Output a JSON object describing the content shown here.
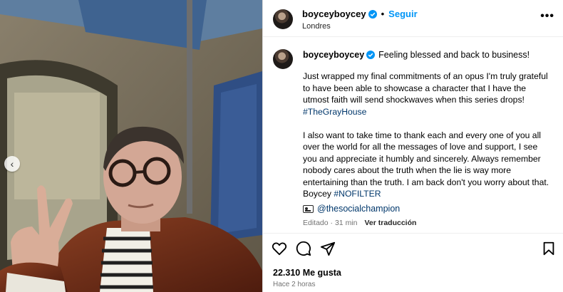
{
  "post": {
    "username": "boyceyboycey",
    "follow_label": "Seguir",
    "separator": "•",
    "location": "Londres",
    "more_label": "•••",
    "caption": {
      "username": "boyceyboycey",
      "first_line": "Feeling blessed and back to business!",
      "paragraph1": "Just wrapped my final commitments of an opus I'm truly grateful to have been able to showcase a character that I have the utmost faith will send shockwaves when this series drops!",
      "hashtag1": "#TheGrayHouse",
      "paragraph2": "I also want to take time to thank each and every one of you all over the world for all the messages of love and support, I see you and appreciate it humbly and sincerely. Always remember nobody cares about the truth when the lie is way more entertaining than the truth. I am back don't you worry about that. Boycey",
      "hashtag2": "#NOFILTER"
    },
    "credit_mention": "@thesocialchampion",
    "edited_label": "Editado",
    "edited_time": "31 min",
    "edited_sep": "·",
    "translate_label": "Ver traducción",
    "likes": "22.310 Me gusta",
    "posted_time": "Hace 2 horas",
    "carousel_prev": "‹"
  },
  "icons": {
    "verified": "verified-badge-icon",
    "like": "heart-icon",
    "comment": "comment-icon",
    "share": "share-icon",
    "save": "bookmark-icon",
    "tagged": "photo-tag-icon"
  },
  "colors": {
    "accent": "#0095f6",
    "hashtag": "#00376b",
    "secondary_text": "#737373"
  }
}
